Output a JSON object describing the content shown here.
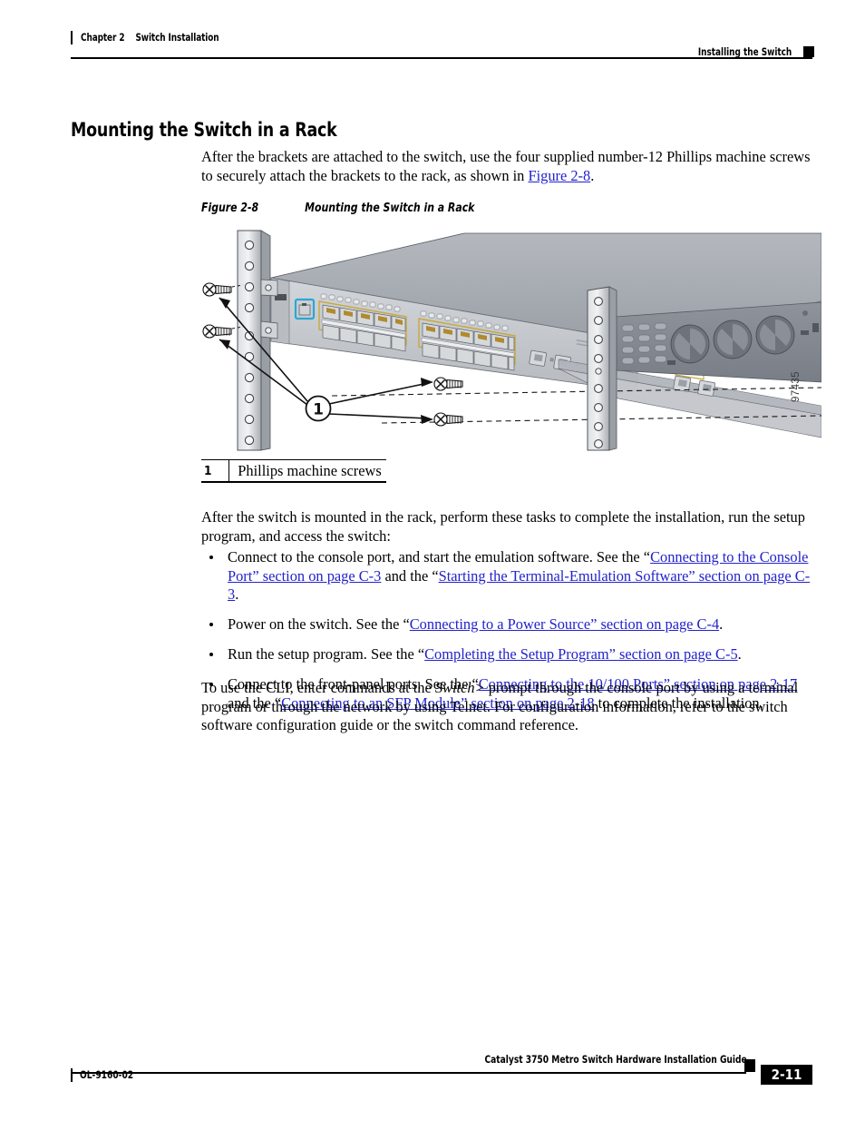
{
  "header": {
    "chapter": "Chapter 2",
    "chapter_title": "Switch Installation",
    "running_head": "Installing the Switch"
  },
  "section": {
    "title": "Mounting the Switch in a Rack",
    "intro_1": "After the brackets are attached to the switch, use the four supplied number-12 Phillips machine screws to securely attach the brackets to the rack, as shown in ",
    "intro_link": "Figure 2-8",
    "intro_1_end": "."
  },
  "figure": {
    "label": "Figure 2-8",
    "title": "Mounting the Switch in a Rack",
    "art_id": "97435",
    "callout_number": "1",
    "callout_label": "Phillips machine screws"
  },
  "body": {
    "after_mount": "After the switch is mounted in the rack, perform these tasks to complete the installation, run the setup program, and access the switch:",
    "cli_1": "To use the CLI, enter commands at the ",
    "cli_prompt": "Switch>",
    "cli_2": " prompt through the console port by using a terminal program or through the network by using Telnet. For configuration information, refer to the switch software configuration guide or the switch command reference."
  },
  "bullets": [
    {
      "t1": "Connect to the console port, and start the emulation software. See the “",
      "l1": "Connecting to the Console Port” section on page C-3",
      "t2": " and the “",
      "l2": "Starting the Terminal-Emulation Software” section on page C-3",
      "t3": "."
    },
    {
      "t1": "Power on the switch. See the “",
      "l1": "Connecting to a Power Source” section on page C-4",
      "t2": "",
      "l2": "",
      "t3": "."
    },
    {
      "t1": "Run the setup program. See the “",
      "l1": "Completing the Setup Program” section on page C-5",
      "t2": "",
      "l2": "",
      "t3": "."
    },
    {
      "t1": "Connect to the front-panel ports. See the “",
      "l1": "Connecting to the 10/100 Ports” section on page 2-17",
      "t2": " and the “",
      "l2": "Connecting to an SFP Module” section on page 2-18",
      "t3": " to complete the installation."
    }
  ],
  "footer": {
    "doc_title": "Catalyst 3750 Metro Switch Hardware Installation Guide",
    "doc_number": "OL-9160-02",
    "page_number": "2-11"
  },
  "colors": {
    "link": "#2222cc",
    "chassis_top": "#a9adb4",
    "chassis_face": "#c3c6cb",
    "console_port": "#2ba7d4",
    "port_outline": "#c8a93c"
  }
}
